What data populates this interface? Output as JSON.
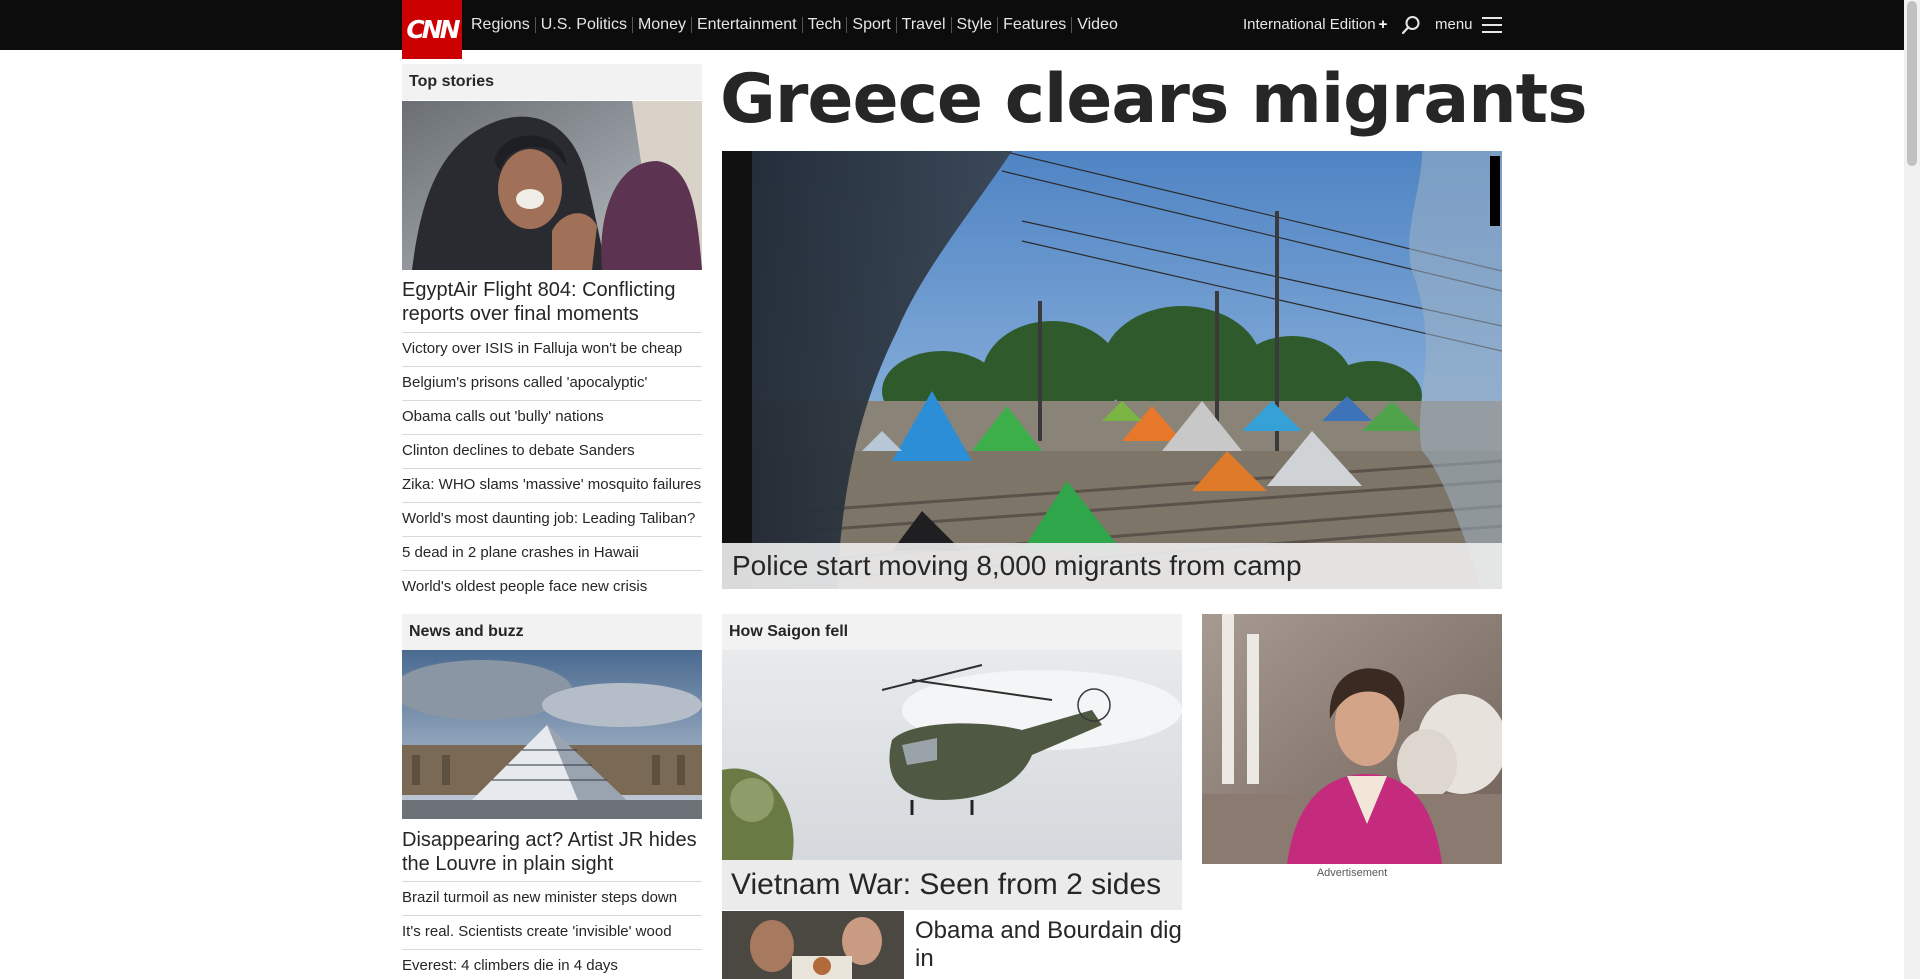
{
  "header": {
    "logo": "CNN",
    "nav": [
      "Regions",
      "U.S. Politics",
      "Money",
      "Entertainment",
      "Tech",
      "Sport",
      "Travel",
      "Style",
      "Features",
      "Video"
    ],
    "edition": "International Edition",
    "edition_plus": "+",
    "menu": "menu"
  },
  "top_stories": {
    "heading": "Top stories",
    "lead": "EgyptAir Flight 804: Conflicting reports over final moments",
    "items": [
      "Victory over ISIS in Falluja won't be cheap",
      "Belgium's prisons called 'apocalyptic'",
      "Obama calls out 'bully' nations",
      "Clinton declines to debate Sanders",
      "Zika: WHO slams 'massive' mosquito failures",
      "World's most daunting job: Leading Taliban?",
      "5 dead in 2 plane crashes in Hawaii",
      "World's oldest people face new crisis"
    ]
  },
  "hero": {
    "headline": "Greece clears migrants",
    "caption": "Police start moving 8,000 migrants from camp"
  },
  "news_buzz": {
    "heading": "News and buzz",
    "lead": "Disappearing act? Artist JR hides the Louvre in plain sight",
    "items": [
      "Brazil turmoil as new minister steps down",
      "It's real. Scientists create 'invisible' wood",
      "Everest: 4 climbers die in 4 days"
    ]
  },
  "saigon": {
    "heading": "How Saigon fell",
    "caption": "Vietnam War: Seen from 2 sides",
    "second": "Obama and Bourdain dig in"
  },
  "ad": {
    "label": "Advertisement"
  }
}
